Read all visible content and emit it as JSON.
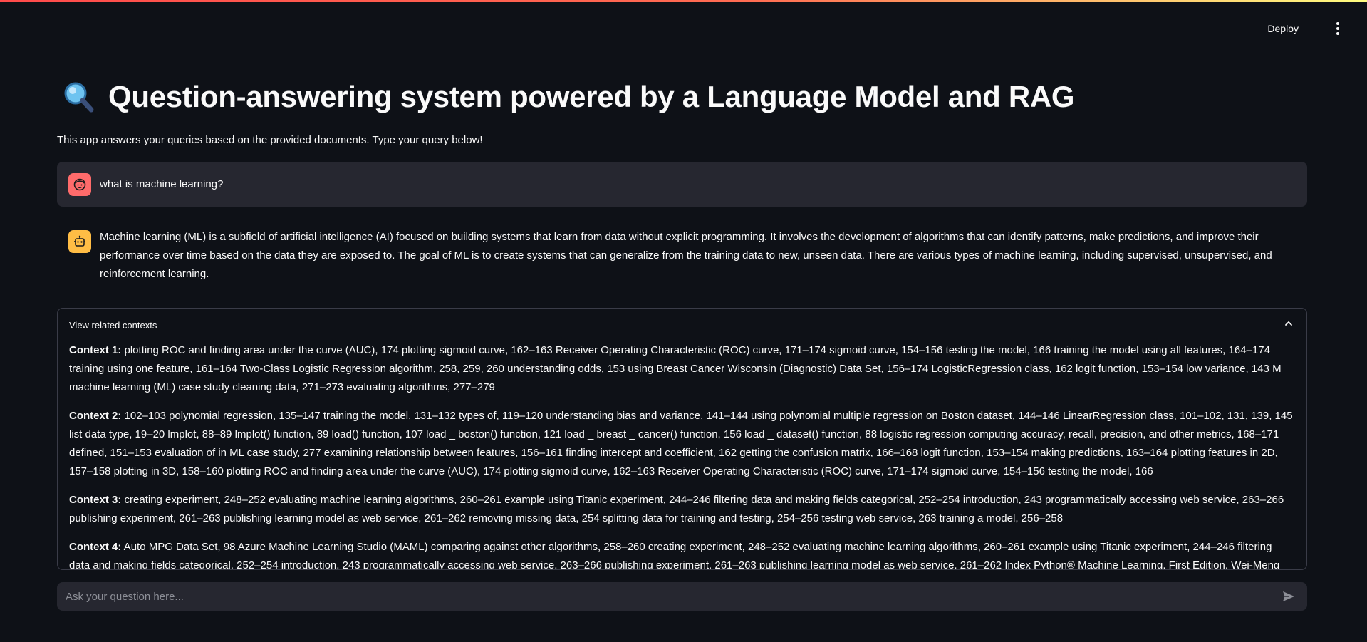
{
  "header": {
    "deploy_label": "Deploy",
    "menu_icon": "vertical-ellipsis-icon"
  },
  "page": {
    "title_icon": "magnifying-glass-icon",
    "title": "Question-answering system powered by a Language Model and RAG",
    "subtitle": "This app answers your queries based on the provided documents. Type your query below!"
  },
  "chat": {
    "user_message": "what is machine learning?",
    "user_avatar": "user-face-icon",
    "assistant_avatar": "robot-icon",
    "assistant_message": "Machine learning (ML) is a subfield of artificial intelligence (AI) focused on building systems that learn from data without explicit programming. It involves the development of algorithms that can identify patterns, make predictions, and improve their performance over time based on the data they are exposed to. The goal of ML is to create systems that can generalize from the training data to new, unseen data. There are various types of machine learning, including supervised, unsupervised, and reinforcement learning."
  },
  "expander": {
    "label": "View related contexts",
    "contexts": [
      {
        "label": "Context 1:",
        "text": " plotting ROC and finding area under the curve (AUC), 174 plotting sigmoid curve, 162–163 Receiver Operating Characteristic (ROC) curve, 171–174 sigmoid curve, 154–156 testing the model, 166 training the model using all features, 164–174 training using one feature, 161–164 Two-Class Logistic Regression algorithm, 258, 259, 260 understanding odds, 153 using Breast Cancer Wisconsin (Diagnostic) Data Set, 156–174 LogisticRegression class, 162 logit function, 153–154 low variance, 143 M machine learning (ML) case study cleaning data, 271–273 evaluating algorithms, 277–279"
      },
      {
        "label": "Context 2:",
        "text": " 102–103 polynomial regression, 135–147 training the model, 131–132 types of, 119–120 understanding bias and variance, 141–144 using polynomial multiple regression on Boston dataset, 144–146 LinearRegression class, 101–102, 131, 139, 145 list data type, 19–20 lmplot, 88–89 lmplot() function, 89 load() function, 107 load _ boston() function, 121 load _ breast _ cancer() function, 156 load _ dataset() function, 88 logistic regression computing accuracy, recall, precision, and other metrics, 168–171 defined, 151–153 evaluation of in ML case study, 277 examining relationship between features, 156–161 finding intercept and coefficient, 162 getting the confusion matrix, 166–168 logit function, 153–154 making predictions, 163–164 plotting features in 2D, 157–158 plotting in 3D, 158–160 plotting ROC and finding area under the curve (AUC), 174 plotting sigmoid curve, 162–163 Receiver Operating Characteristic (ROC) curve, 171–174 sigmoid curve, 154–156 testing the model, 166"
      },
      {
        "label": "Context 3:",
        "text": " creating experiment, 248–252 evaluating machine learning algorithms, 260–261 example using Titanic experiment, 244–246 filtering data and making fields categorical, 252–254 introduction, 243 programmatically accessing web service, 263–266 publishing experiment, 261–263 publishing learning model as web service, 261–262 removing missing data, 254 splitting data for training and testing, 254–256 testing web service, 263 training a model, 256–258"
      },
      {
        "label": "Context 4:",
        "text": " Auto MPG Data Set, 98 Azure Machine Learning Studio (MAML) comparing against other algorithms, 258–260 creating experiment, 248–252 evaluating machine learning algorithms, 260–261 example using Titanic experiment, 244–246 filtering data and making fields categorical, 252–254 introduction, 243 programmatically accessing web service, 263–266 publishing experiment, 261–263 publishing learning model as web service, 261–262 Index Python® Machine Learning, First Edition. Wei-Meng Lee. ©"
      }
    ]
  },
  "input": {
    "placeholder": "Ask your question here...",
    "value": "",
    "send_icon": "send-arrow-icon"
  },
  "colors": {
    "background": "#0e1117",
    "surface": "#262730",
    "user_avatar": "#ff6b6b",
    "assistant_avatar": "#ffbd45",
    "accent_start": "#ff4b4b",
    "accent_end": "#fffd80"
  }
}
